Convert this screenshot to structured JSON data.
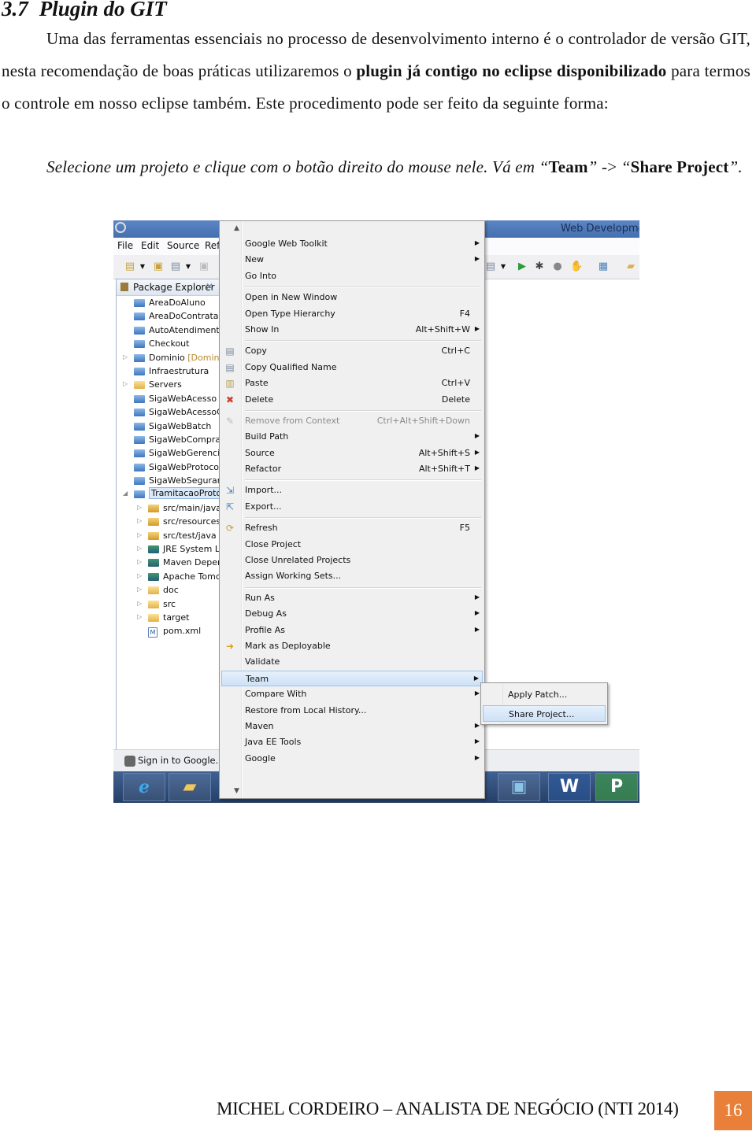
{
  "heading": {
    "number": "3.7",
    "title": "Plugin do GIT"
  },
  "paragraph1": {
    "text_a": "Uma das ferramentas essenciais no processo de desenvolvimento interno é o controlador de versão GIT, nesta recomendação de boas práticas utilizaremos o ",
    "bold": "plugin já contigo no eclipse disponibilizado",
    "text_b": " para termos o controle em nosso eclipse também. Este procedimento pode ser feito da seguinte forma:"
  },
  "paragraph2": {
    "text_a": "Selecione um projeto e clique com o botão direito do mouse nele. Vá em “",
    "bold_1": "Team",
    "text_b": "” ",
    "arrow": "->",
    "text_c": " “",
    "bold_2": "Share Project",
    "text_d": "”."
  },
  "screenshot": {
    "window_title": "Web Developme",
    "menubar": [
      "File",
      "Edit",
      "Source",
      "Ref"
    ],
    "package_explorer": {
      "title": "Package Explorer",
      "items": [
        {
          "label": "AreaDoAluno",
          "icon": "project",
          "level": 0,
          "twisty": false
        },
        {
          "label": "AreaDoContratar",
          "icon": "project",
          "level": 0,
          "twisty": false
        },
        {
          "label": "AutoAtendiment",
          "icon": "project",
          "level": 0,
          "twisty": false
        },
        {
          "label": "Checkout",
          "icon": "project",
          "level": 0,
          "twisty": false
        },
        {
          "label": "Dominio",
          "decoration": " [Domin",
          "icon": "maven-project",
          "level": 0,
          "twisty": "collapsed"
        },
        {
          "label": "Infraestrutura",
          "icon": "project",
          "level": 0,
          "twisty": false
        },
        {
          "label": "Servers",
          "icon": "folder",
          "level": 0,
          "twisty": "collapsed"
        },
        {
          "label": "SigaWebAcesso",
          "icon": "project",
          "level": 0,
          "twisty": false
        },
        {
          "label": "SigaWebAcessoC",
          "icon": "project",
          "level": 0,
          "twisty": false
        },
        {
          "label": "SigaWebBatch",
          "icon": "project",
          "level": 0,
          "twisty": false
        },
        {
          "label": "SigaWebCompra",
          "icon": "project",
          "level": 0,
          "twisty": false
        },
        {
          "label": "SigaWebGerencia",
          "icon": "project",
          "level": 0,
          "twisty": false
        },
        {
          "label": "SigaWebProtocol",
          "icon": "project",
          "level": 0,
          "twisty": false
        },
        {
          "label": "SigaWebSeguran",
          "icon": "project",
          "level": 0,
          "twisty": false
        },
        {
          "label": "TramitacaoProto",
          "icon": "maven-project",
          "level": 0,
          "twisty": "expanded",
          "selected": true
        },
        {
          "label": "src/main/java",
          "icon": "package",
          "level": 1,
          "twisty": "collapsed"
        },
        {
          "label": "src/resources",
          "icon": "package",
          "level": 1,
          "twisty": "collapsed"
        },
        {
          "label": "src/test/java",
          "icon": "package",
          "level": 1,
          "twisty": "collapsed"
        },
        {
          "label": "JRE System Li",
          "icon": "library",
          "level": 1,
          "twisty": "collapsed"
        },
        {
          "label": "Maven Depen",
          "icon": "library",
          "level": 1,
          "twisty": "collapsed"
        },
        {
          "label": "Apache Tomc",
          "icon": "library",
          "level": 1,
          "twisty": "collapsed"
        },
        {
          "label": "doc",
          "icon": "folder",
          "level": 1,
          "twisty": "collapsed"
        },
        {
          "label": "src",
          "icon": "folder",
          "level": 1,
          "twisty": "collapsed"
        },
        {
          "label": "target",
          "icon": "folder",
          "level": 1,
          "twisty": "collapsed"
        },
        {
          "label": "pom.xml",
          "icon": "xml-file",
          "level": 1,
          "twisty": false
        }
      ]
    },
    "status_bar": {
      "sign_in": "Sign in to Google..."
    },
    "context_menu": [
      {
        "label": "Google Web Toolkit",
        "submenu": true
      },
      {
        "label": "New",
        "submenu": true
      },
      {
        "label": "Go Into"
      },
      {
        "separator": true
      },
      {
        "label": "Open in New Window"
      },
      {
        "label": "Open Type Hierarchy",
        "shortcut": "F4"
      },
      {
        "label": "Show In",
        "shortcut": "Alt+Shift+W",
        "submenu": true
      },
      {
        "separator": true
      },
      {
        "label": "Copy",
        "shortcut": "Ctrl+C",
        "icon": "copy-icon"
      },
      {
        "label": "Copy Qualified Name",
        "icon": "copy-qualified-icon"
      },
      {
        "label": "Paste",
        "shortcut": "Ctrl+V",
        "icon": "paste-icon"
      },
      {
        "label": "Delete",
        "shortcut": "Delete",
        "icon": "delete-icon"
      },
      {
        "separator": true
      },
      {
        "label": "Remove from Context",
        "shortcut": "Ctrl+Alt+Shift+Down",
        "icon": "remove-context-icon",
        "disabled": true
      },
      {
        "label": "Build Path",
        "submenu": true
      },
      {
        "label": "Source",
        "shortcut": "Alt+Shift+S",
        "submenu": true
      },
      {
        "label": "Refactor",
        "shortcut": "Alt+Shift+T",
        "submenu": true
      },
      {
        "separator": true
      },
      {
        "label": "Import...",
        "icon": "import-icon"
      },
      {
        "label": "Export...",
        "icon": "export-icon"
      },
      {
        "separator": true
      },
      {
        "label": "Refresh",
        "shortcut": "F5",
        "icon": "refresh-icon"
      },
      {
        "label": "Close Project"
      },
      {
        "label": "Close Unrelated Projects"
      },
      {
        "label": "Assign Working Sets..."
      },
      {
        "separator": true
      },
      {
        "label": "Run As",
        "submenu": true
      },
      {
        "label": "Debug As",
        "submenu": true
      },
      {
        "label": "Profile As",
        "submenu": true
      },
      {
        "label": "Mark as Deployable",
        "icon": "deployable-icon"
      },
      {
        "label": "Validate"
      },
      {
        "label": "Team",
        "submenu": true,
        "highlighted": true
      },
      {
        "label": "Compare With",
        "submenu": true
      },
      {
        "label": "Restore from Local History..."
      },
      {
        "label": "Maven",
        "submenu": true
      },
      {
        "label": "Java EE Tools",
        "submenu": true
      },
      {
        "label": "Google",
        "submenu": true
      }
    ],
    "team_submenu": [
      {
        "label": "Apply Patch..."
      },
      {
        "label": "Share Project...",
        "highlighted": true
      }
    ],
    "taskbar": [
      "internet-explorer",
      "file-explorer",
      "photos",
      "word",
      "project"
    ]
  },
  "footer": {
    "text": "MICHEL CORDEIRO – ANALISTA DE NEGÓCIO (NTI 2014)",
    "page": "16"
  },
  "colors": {
    "accent": "#e8803a",
    "menu_highlight": "#cde1f7",
    "titlebar": "#4f7bbd"
  }
}
